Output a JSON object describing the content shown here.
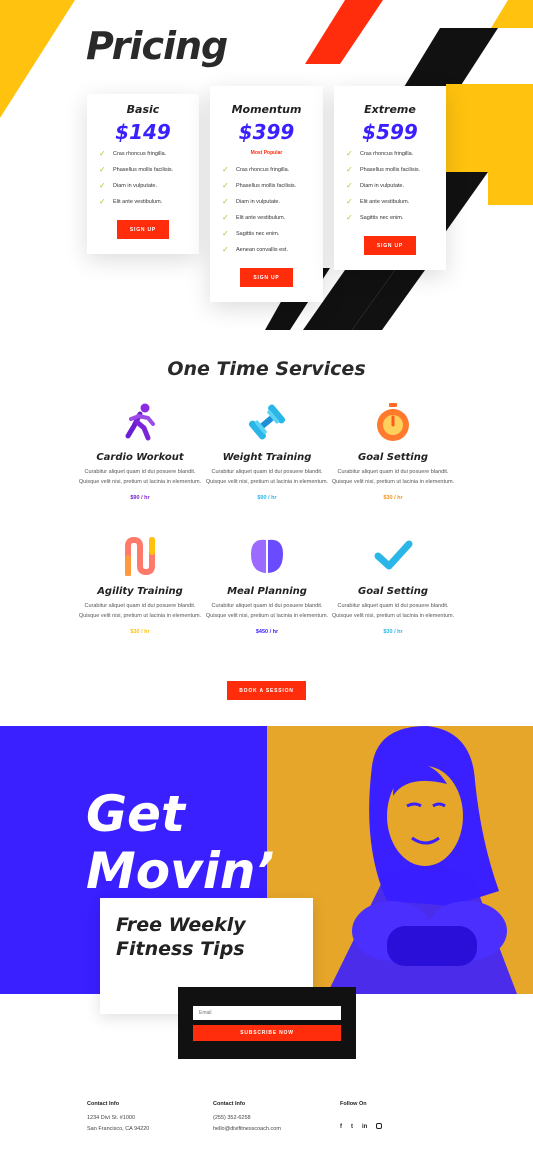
{
  "colors": {
    "yellow": "#ffc20e",
    "red": "#ff2d0c",
    "black": "#111111",
    "blue": "#3a1fff",
    "purple": "#7b25d6",
    "cyan": "#2bb6e8",
    "orange": "#f7941d",
    "check": "#9acd32",
    "white": "#ffffff"
  },
  "pricing": {
    "title": "Pricing",
    "plans": [
      {
        "name": "Basic",
        "price": "$149",
        "button": "SIGN UP",
        "features": [
          "Cras rhoncus fringilla.",
          "Phasellus mollis facilisis.",
          "Diam in vulputate.",
          "Elit ante vestibulum."
        ]
      },
      {
        "name": "Momentum",
        "price": "$399",
        "badge": "Most Popular",
        "button": "SIGN UP",
        "features": [
          "Cras rhoncus fringilla.",
          "Phasellus mollis facilisis.",
          "Diam in vulputate.",
          "Elit ante vestibulum.",
          "Sagittis nec enim.",
          "Aenean convallis est."
        ]
      },
      {
        "name": "Extreme",
        "price": "$599",
        "button": "SIGN UP",
        "features": [
          "Cras rhoncus fringilla.",
          "Phasellus mollis facilisis.",
          "Diam in vulputate.",
          "Elit ante vestibulum.",
          "Sagittis nec enim."
        ]
      }
    ]
  },
  "services": {
    "title": "One Time Services",
    "items": [
      {
        "name": "Cardio Workout",
        "desc": "Curabitur aliquet quam id dui posuere blandit. Quisque velit nisi, pretium ut lacinia in elementum.",
        "price": "$90 / hr",
        "icon": "running-person-icon",
        "color": "#7b25d6"
      },
      {
        "name": "Weight Training",
        "desc": "Curabitur aliquet quam id dui posuere blandit. Quisque velit nisi, pretium ut lacinia in elementum.",
        "price": "$90 / hr",
        "icon": "dumbbell-icon",
        "color": "#2bb6e8"
      },
      {
        "name": "Goal Setting",
        "desc": "Curabitur aliquet quam id dui posuere blandit. Quisque velit nisi, pretium ut lacinia in elementum.",
        "price": "$30 / hr",
        "icon": "stopwatch-icon",
        "color": "#f7941d"
      },
      {
        "name": "Agility Training",
        "desc": "Curabitur aliquet quam id dui posuere blandit. Quisque velit nisi, pretium ut lacinia in elementum.",
        "price": "$30 / hr",
        "icon": "agility-path-icon",
        "color": "#ffc20e"
      },
      {
        "name": "Meal Planning",
        "desc": "Curabitur aliquet quam id dui posuere blandit. Quisque velit nisi, pretium ut lacinia in elementum.",
        "price": "$450 / hr",
        "icon": "food-icon",
        "color": "#3a1fff"
      },
      {
        "name": "Goal Setting",
        "desc": "Curabitur aliquet quam id dui posuere blandit. Quisque velit nisi, pretium ut lacinia in elementum.",
        "price": "$30 / hr",
        "icon": "checkmark-icon",
        "color": "#2bb6e8"
      }
    ],
    "cta": "BOOK A SESSION"
  },
  "hero": {
    "headline_1": "Get",
    "headline_2": "Movin’",
    "tips_1": "Free Weekly",
    "tips_2": "Fitness Tips",
    "email_placeholder": "Email",
    "subscribe": "SUBSCRIBE NOW"
  },
  "footer": {
    "col1": {
      "heading": "Contact Info",
      "line1": "1234 Divi St. #1000",
      "line2": "San Francisco, CA 94220"
    },
    "col2": {
      "heading": "Contact Info",
      "line1": "(255) 352-6258",
      "line2": "hello@divifitnesscoach.com"
    },
    "col3": {
      "heading": "Follow On",
      "social": [
        "f",
        "t",
        "in",
        "ig"
      ]
    }
  }
}
